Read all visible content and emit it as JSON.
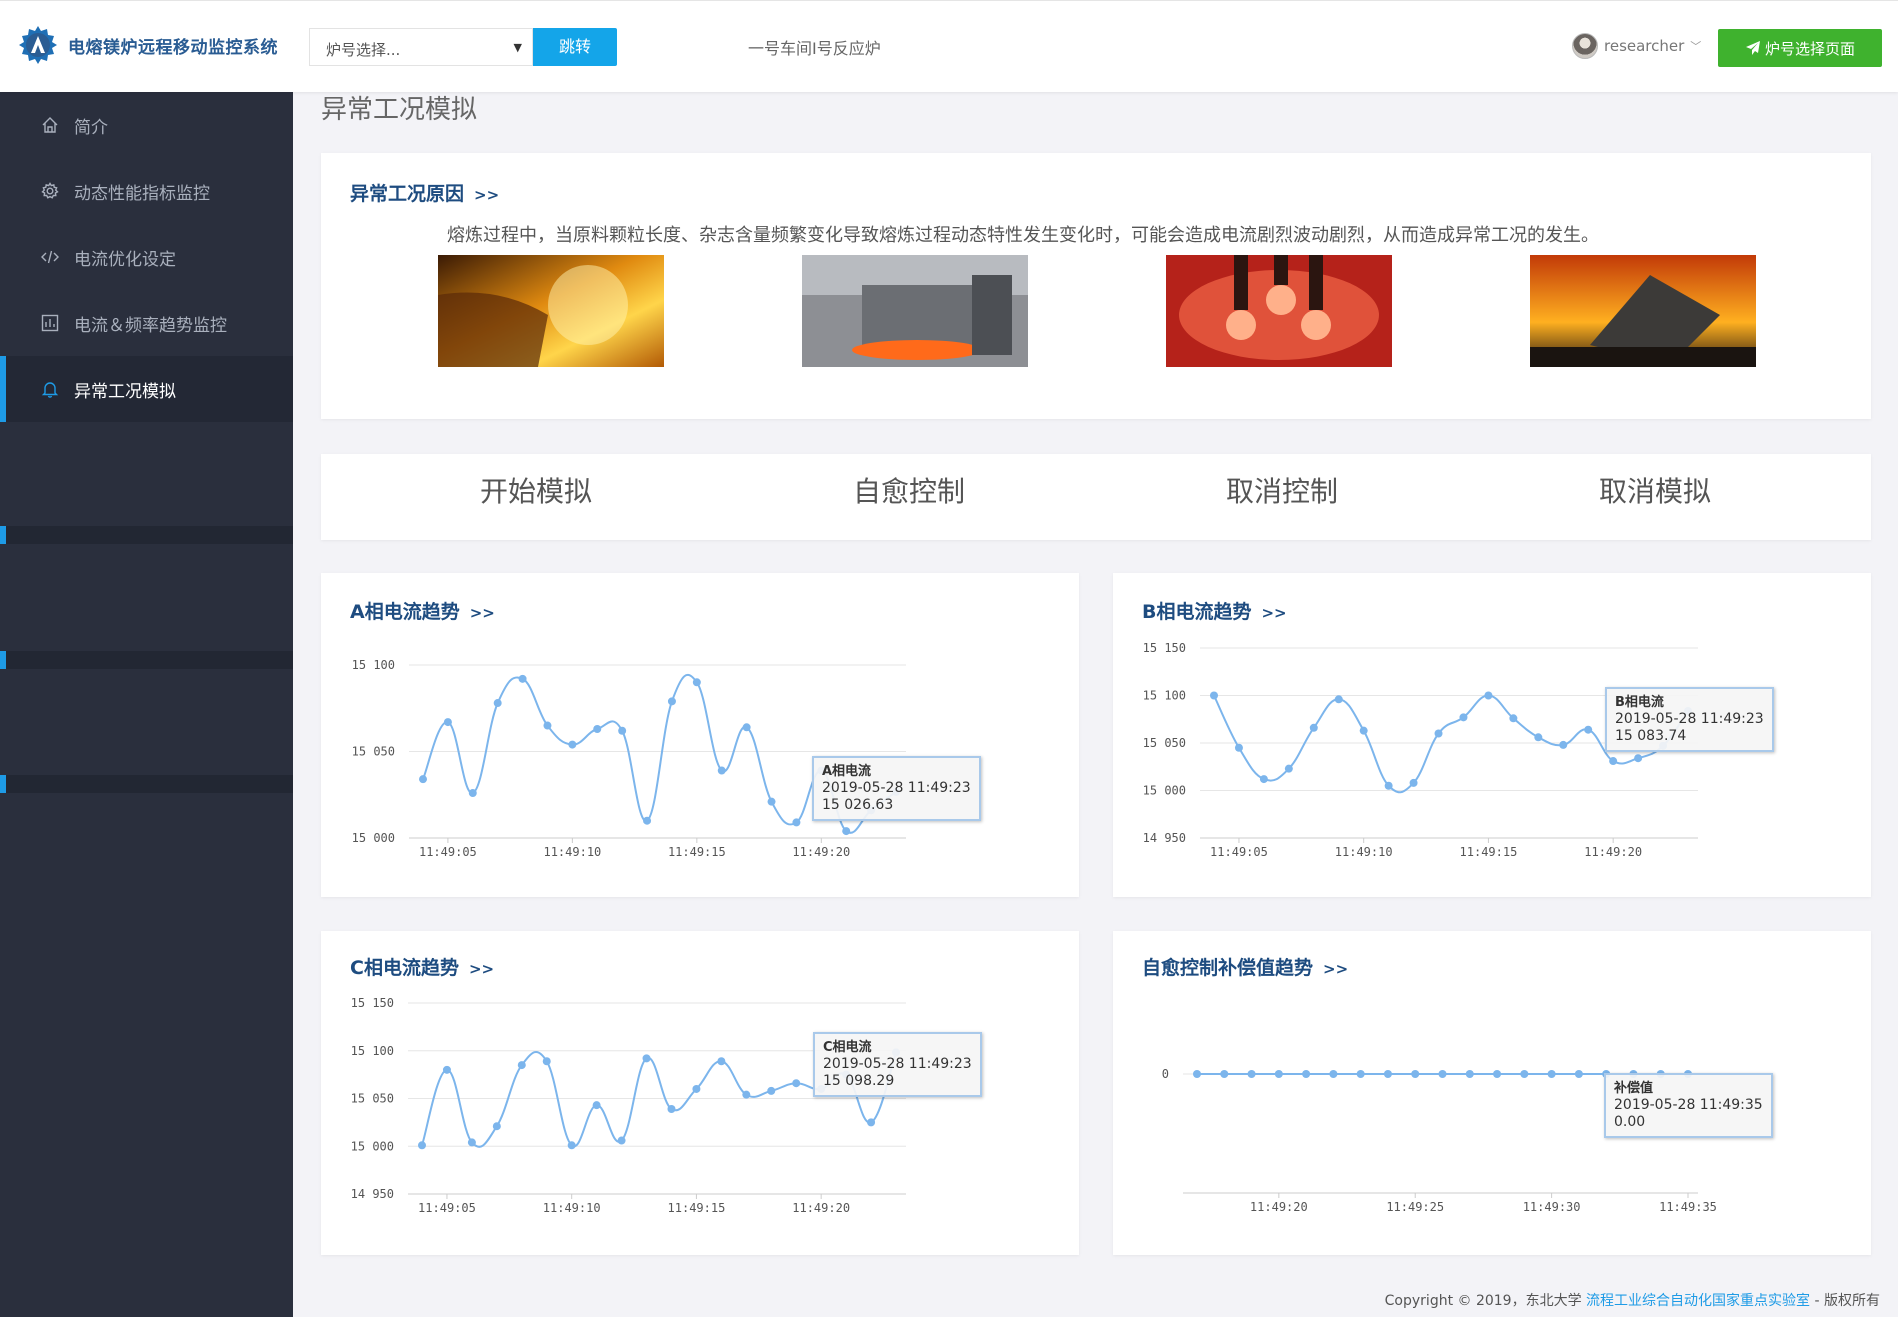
{
  "header": {
    "app_title": "电熔镁炉远程移动监控系统",
    "furnace_select_placeholder": "炉号选择...",
    "jump_label": "跳转",
    "workshop": "一号车间I号反应炉",
    "username": "researcher",
    "page_button_label": "炉号选择页面"
  },
  "sidebar": {
    "items": [
      {
        "label": "简介",
        "icon": "home-icon"
      },
      {
        "label": "动态性能指标监控",
        "icon": "gear-icon"
      },
      {
        "label": "电流优化设定",
        "icon": "code-icon"
      },
      {
        "label": "电流＆频率趋势监控",
        "icon": "chart-icon"
      },
      {
        "label": "异常工况模拟",
        "icon": "bell-icon",
        "active": true
      }
    ]
  },
  "page_title": "异常工况模拟",
  "cause_card": {
    "title": "异常工况原因",
    "arrow": ">>",
    "description": "熔炼过程中，当原料颗粒长度、杂志含量频繁变化导致熔炼过程动态特性发生变化时，可能会造成电流剧烈波动剧烈，从而造成异常工况的发生。"
  },
  "controls": {
    "start": "开始模拟",
    "self_heal": "自愈控制",
    "cancel_control": "取消控制",
    "cancel_sim": "取消模拟"
  },
  "charts": {
    "a": {
      "title": "A相电流趋势",
      "arrow": ">>",
      "tooltip": {
        "name": "A相电流",
        "time": "2019-05-28 11:49:23",
        "value": "15 026.63"
      }
    },
    "b": {
      "title": "B相电流趋势",
      "arrow": ">>",
      "tooltip": {
        "name": "B相电流",
        "time": "2019-05-28 11:49:23",
        "value": "15 083.74"
      }
    },
    "c": {
      "title": "C相电流趋势",
      "arrow": ">>",
      "tooltip": {
        "name": "C相电流",
        "time": "2019-05-28 11:49:23",
        "value": "15 098.29"
      }
    },
    "d": {
      "title": "自愈控制补偿值趋势",
      "arrow": ">>",
      "tooltip": {
        "name": "补偿值",
        "time": "2019-05-28 11:49:35",
        "value": "0.00"
      }
    }
  },
  "footer": {
    "prefix": "Copyright © 2019，东北大学 ",
    "lab": "流程工业综合自动化国家重点实验室",
    "suffix": " - 版权所有"
  },
  "colors": {
    "accent": "#1e9be6",
    "series": "#7cb5ec",
    "title": "#1e4c80",
    "green": "#3fb22e"
  },
  "chart_data": [
    {
      "type": "line",
      "name": "A",
      "x": [
        "11:49:04",
        "11:49:05",
        "11:49:06",
        "11:49:07",
        "11:49:08",
        "11:49:09",
        "11:49:10",
        "11:49:11",
        "11:49:12",
        "11:49:13",
        "11:49:14",
        "11:49:15",
        "11:49:16",
        "11:49:17",
        "11:49:18",
        "11:49:19",
        "11:49:20",
        "11:49:21",
        "11:49:22",
        "11:49:23"
      ],
      "values": [
        15034,
        15067,
        15026,
        15078,
        15092,
        15065,
        15054,
        15063,
        15062,
        15010,
        15079,
        15090,
        15039,
        15064,
        15021,
        15009,
        15039,
        15004,
        15016,
        15026.63
      ],
      "xticks": [
        "11:49:05",
        "11:49:10",
        "11:49:15",
        "11:49:20"
      ],
      "yticks": [
        "15 000",
        "15 050",
        "15 100"
      ],
      "ylim": [
        15000,
        15100
      ]
    },
    {
      "type": "line",
      "name": "B",
      "x": [
        "11:49:04",
        "11:49:05",
        "11:49:06",
        "11:49:07",
        "11:49:08",
        "11:49:09",
        "11:49:10",
        "11:49:11",
        "11:49:12",
        "11:49:13",
        "11:49:14",
        "11:49:15",
        "11:49:16",
        "11:49:17",
        "11:49:18",
        "11:49:19",
        "11:49:20",
        "11:49:21",
        "11:49:22",
        "11:49:23"
      ],
      "values": [
        15100,
        15045,
        15012,
        15023,
        15066,
        15096,
        15063,
        15005,
        15008,
        15060,
        15077,
        15100,
        15076,
        15056,
        15048,
        15064,
        15031,
        15034,
        15047,
        15083.74
      ],
      "xticks": [
        "11:49:05",
        "11:49:10",
        "11:49:15",
        "11:49:20"
      ],
      "yticks": [
        "14 950",
        "15 000",
        "15 050",
        "15 100",
        "15 150"
      ],
      "ylim": [
        14950,
        15150
      ]
    },
    {
      "type": "line",
      "name": "C",
      "x": [
        "11:49:04",
        "11:49:05",
        "11:49:06",
        "11:49:07",
        "11:49:08",
        "11:49:09",
        "11:49:10",
        "11:49:11",
        "11:49:12",
        "11:49:13",
        "11:49:14",
        "11:49:15",
        "11:49:16",
        "11:49:17",
        "11:49:18",
        "11:49:19",
        "11:49:20",
        "11:49:21",
        "11:49:22",
        "11:49:23"
      ],
      "values": [
        15001,
        15080,
        15004,
        15021,
        15085,
        15089,
        15001,
        15043,
        15006,
        15092,
        15039,
        15060,
        15089,
        15054,
        15058,
        15066,
        15060,
        15075,
        15025,
        15098.29
      ],
      "xticks": [
        "11:49:05",
        "11:49:10",
        "11:49:15",
        "11:49:20"
      ],
      "yticks": [
        "14 950",
        "15 000",
        "15 050",
        "15 100",
        "15 150"
      ],
      "ylim": [
        14950,
        15150
      ]
    },
    {
      "type": "line",
      "name": "补偿值",
      "x": [
        "11:49:17",
        "11:49:18",
        "11:49:19",
        "11:49:20",
        "11:49:21",
        "11:49:22",
        "11:49:23",
        "11:49:24",
        "11:49:25",
        "11:49:26",
        "11:49:27",
        "11:49:28",
        "11:49:29",
        "11:49:30",
        "11:49:31",
        "11:49:32",
        "11:49:33",
        "11:49:34",
        "11:49:35"
      ],
      "values": [
        0,
        0,
        0,
        0,
        0,
        0,
        0,
        0,
        0,
        0,
        0,
        0,
        0,
        0,
        0,
        0,
        0,
        0,
        0
      ],
      "xticks": [
        "11:49:20",
        "11:49:25",
        "11:49:30",
        "11:49:35"
      ],
      "yticks": [
        "0"
      ],
      "ylim": [
        -1,
        1
      ]
    }
  ]
}
